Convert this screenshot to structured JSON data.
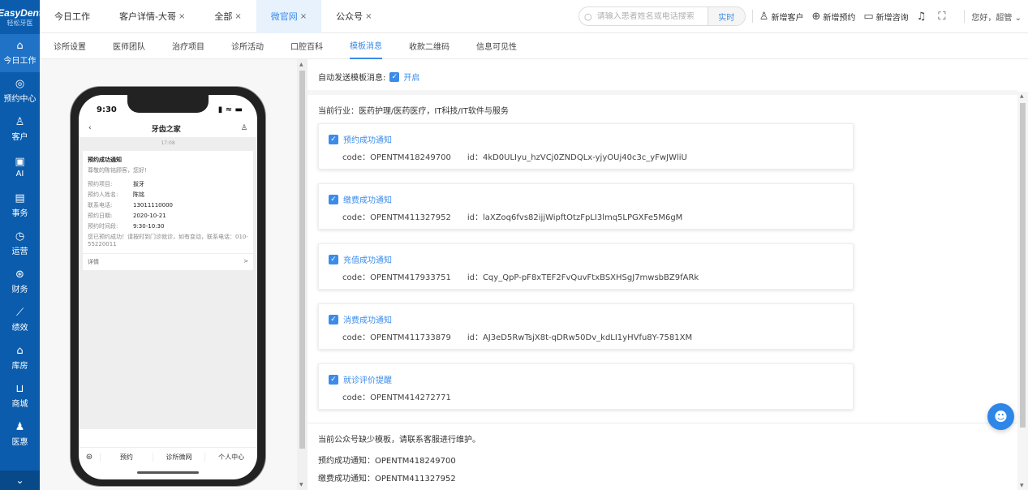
{
  "brand": {
    "name": "EasyDent",
    "sub": "轻松牙医"
  },
  "sidebar": {
    "items": [
      {
        "icon": "⌂",
        "label": "今日工作",
        "active": true
      },
      {
        "icon": "◎",
        "label": "预约中心"
      },
      {
        "icon": "♙",
        "label": "客户"
      },
      {
        "icon": "▣",
        "label": "AI"
      },
      {
        "icon": "▤",
        "label": "事务"
      },
      {
        "icon": "◷",
        "label": "运营"
      },
      {
        "icon": "⊛",
        "label": "财务"
      },
      {
        "icon": "⟋",
        "label": "绩效"
      },
      {
        "icon": "⌂",
        "label": "库房"
      },
      {
        "icon": "⊔",
        "label": "商城"
      },
      {
        "icon": "♟",
        "label": "医惠"
      }
    ],
    "bottom": "⌄"
  },
  "tabs": [
    {
      "label": "今日工作",
      "closable": false
    },
    {
      "label": "客户详情-大哥",
      "closable": true
    },
    {
      "label": "全部",
      "closable": true
    },
    {
      "label": "微官网",
      "closable": true,
      "active": true
    },
    {
      "label": "公众号",
      "closable": true
    }
  ],
  "search": {
    "placeholder": "请输入患者姓名或电话搜索",
    "realtime": "实时"
  },
  "actions": {
    "new_customer": "新增客户",
    "new_appointment": "新增预约",
    "new_consult": "新增咨询",
    "greeting": "您好，超管"
  },
  "subtabs": [
    "诊所设置",
    "医师团队",
    "治疗项目",
    "诊所活动",
    "口腔百科",
    "模板消息",
    "收款二维码",
    "信息可见性"
  ],
  "phone": {
    "time": "9:30",
    "title": "牙齿之家",
    "msg_time": "17:08",
    "card_title": "预约成功通知",
    "greeting": "尊敬的陈铭顾客，您好!",
    "rows": [
      {
        "k": "预约项目:",
        "v": "拔牙"
      },
      {
        "k": "预约人姓名:",
        "v": "陈铭"
      },
      {
        "k": "联系电话:",
        "v": "13011110000"
      },
      {
        "k": "预约日期:",
        "v": "2020-10-21"
      },
      {
        "k": "预约时间段:",
        "v": "9:30-10:30"
      }
    ],
    "note": "您已预约成功！请按时到门诊就诊，如有变动，联系电话：010-55220011",
    "detail": "详情",
    "detail_arrow": ">",
    "footer": [
      "预约",
      "诊所微网",
      "个人中心"
    ]
  },
  "content": {
    "auto_send_label": "自动发送模板消息:",
    "auto_send_state": "开启",
    "industry": "当前行业：医药护理/医药医疗，IT科技/IT软件与服务",
    "templates": [
      {
        "title": "预约成功通知",
        "code": "code：OPENTM418249700",
        "id": "id：4kD0ULIyu_hzVCj0ZNDQLx-yjyOUj40c3c_yFwJWliU"
      },
      {
        "title": "缴费成功通知",
        "code": "code：OPENTM411327952",
        "id": "id：laXZoq6fvs82ijjWipftOtzFpLI3lmq5LPGXFe5M6gM"
      },
      {
        "title": "充值成功通知",
        "code": "code：OPENTM417933751",
        "id": "id：Cqy_QpP-pF8xTEF2FvQuvFtxBSXHSgJ7mwsbBZ9fARk"
      },
      {
        "title": "消费成功通知",
        "code": "code：OPENTM411733879",
        "id": "id：AJ3eD5RwTsjX8t-qDRw50Dv_kdLI1yHVfu8Y-7581XM"
      },
      {
        "title": "就诊评价提醒",
        "code": "code：OPENTM414272771",
        "id": ""
      }
    ],
    "missing_header": "当前公众号缺少模板，请联系客服进行维护。",
    "missing": [
      "预约成功通知：OPENTM418249700",
      "缴费成功通知：OPENTM411327952"
    ]
  },
  "colors": {
    "sidebar": "#0b5cad",
    "accent": "#3b8bea",
    "fab": "#2e86e8"
  }
}
